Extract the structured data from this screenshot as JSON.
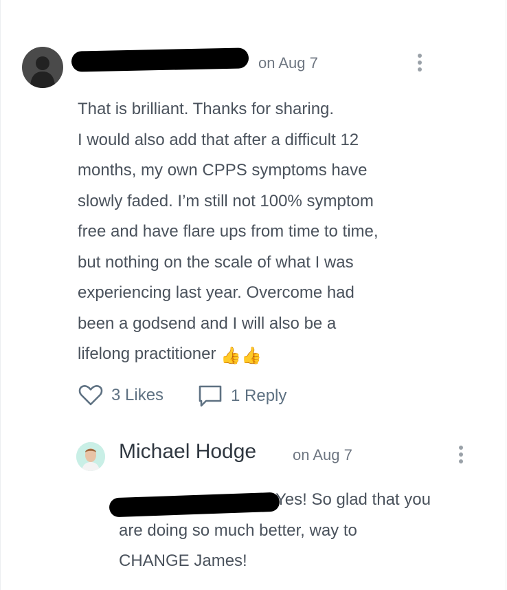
{
  "comment": {
    "timestamp": "on Aug 7",
    "lines": [
      "That is brilliant. Thanks for sharing.",
      "I would also add that after a difficult 12",
      "months, my own CPPS symptoms have",
      "slowly faded. I’m still not 100% symptom",
      "free and have flare ups from time to time,",
      "but nothing on the scale of what I was",
      "experiencing last year. Overcome had",
      "been a godsend and I will also be a",
      "lifelong practitioner"
    ],
    "emoji": "👍👍",
    "likes_label": "3 Likes",
    "reply_label": "1 Reply"
  },
  "reply": {
    "author": "Michael Hodge",
    "timestamp": "on Aug 7",
    "line1": "Yes! So glad that you",
    "line2": "are doing so much better, way to",
    "line3": "CHANGE James!"
  },
  "icons": {
    "heart": "heart-icon",
    "reply": "speech-bubble-icon",
    "more": "more-vertical-icon"
  }
}
